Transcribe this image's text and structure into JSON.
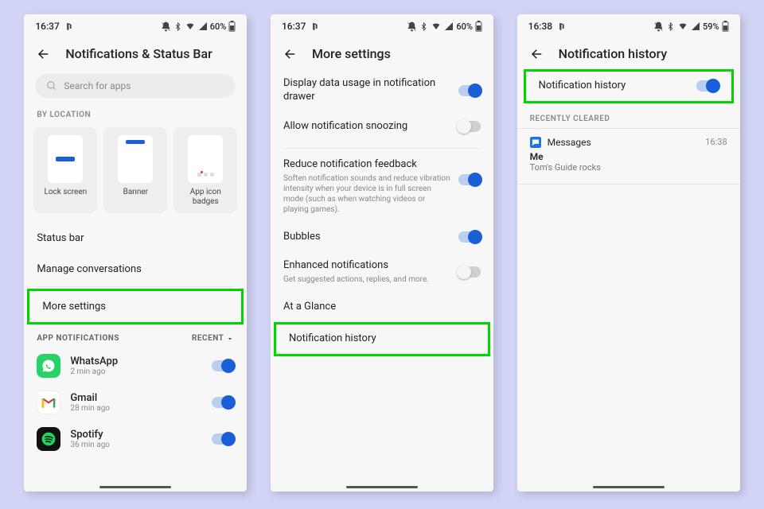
{
  "screen1": {
    "status": {
      "time": "16:37",
      "battery": "60%"
    },
    "title": "Notifications & Status Bar",
    "search_placeholder": "Search for apps",
    "by_location": "BY LOCATION",
    "tiles": {
      "lock": "Lock screen",
      "banner": "Banner",
      "badges": "App icon\nbadges"
    },
    "items": {
      "status_bar": "Status bar",
      "manage_conv": "Manage conversations",
      "more_settings": "More settings"
    },
    "app_notif_label": "APP NOTIFICATIONS",
    "recent_label": "RECENT",
    "apps": [
      {
        "name": "WhatsApp",
        "sub": "2 min ago"
      },
      {
        "name": "Gmail",
        "sub": "28 min ago"
      },
      {
        "name": "Spotify",
        "sub": "36 min ago"
      }
    ]
  },
  "screen2": {
    "status": {
      "time": "16:37",
      "battery": "60%"
    },
    "title": "More settings",
    "rows": {
      "display_usage": "Display data usage in notification drawer",
      "snoozing": "Allow notification snoozing",
      "reduce_title": "Reduce notification feedback",
      "reduce_sub": "Soften notification sounds and reduce vibration intensity when your device is in full screen mode (such as when watching videos or playing games).",
      "bubbles": "Bubbles",
      "enhanced_title": "Enhanced notifications",
      "enhanced_sub": "Get suggested actions, replies, and more.",
      "at_glance": "At a Glance",
      "notif_history": "Notification history"
    }
  },
  "screen3": {
    "status": {
      "time": "16:38",
      "battery": "59%"
    },
    "title": "Notification history",
    "toggle_label": "Notification history",
    "recently_cleared": "RECENTLY CLEARED",
    "msg": {
      "app": "Messages",
      "time": "16:38",
      "from": "Me",
      "body": "Tom's Guide rocks"
    }
  }
}
